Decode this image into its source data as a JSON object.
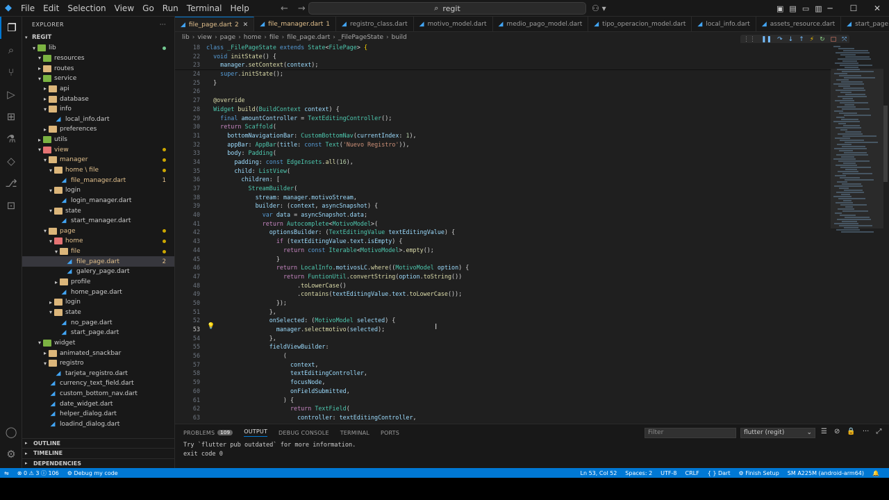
{
  "titlebar": {
    "menu": [
      "File",
      "Edit",
      "Selection",
      "View",
      "Go",
      "Run",
      "Terminal",
      "Help"
    ],
    "search": "regit"
  },
  "explorer": {
    "title": "EXPLORER",
    "root": "REGIT",
    "tree": [
      {
        "d": 1,
        "type": "folder",
        "c": "g",
        "open": true,
        "label": "lib",
        "dot": "g"
      },
      {
        "d": 2,
        "type": "folder",
        "c": "g",
        "open": true,
        "label": "resources"
      },
      {
        "d": 2,
        "type": "folder",
        "c": "",
        "open": false,
        "label": "routes"
      },
      {
        "d": 2,
        "type": "folder",
        "c": "g",
        "open": true,
        "label": "service"
      },
      {
        "d": 3,
        "type": "folder",
        "c": "",
        "open": false,
        "label": "api"
      },
      {
        "d": 3,
        "type": "folder",
        "c": "",
        "open": false,
        "label": "database"
      },
      {
        "d": 3,
        "type": "folder",
        "c": "",
        "open": true,
        "label": "info"
      },
      {
        "d": 4,
        "type": "file",
        "label": "local_info.dart"
      },
      {
        "d": 3,
        "type": "folder",
        "c": "",
        "open": false,
        "label": "preferences"
      },
      {
        "d": 2,
        "type": "folder",
        "c": "g",
        "open": false,
        "label": "utils"
      },
      {
        "d": 2,
        "type": "folder",
        "c": "r",
        "open": true,
        "label": "view",
        "mod": true,
        "dot": "o"
      },
      {
        "d": 3,
        "type": "folder",
        "c": "",
        "open": true,
        "label": "manager",
        "mod": true,
        "dot": "o"
      },
      {
        "d": 4,
        "type": "folder",
        "c": "",
        "open": true,
        "label": "home \\ file",
        "mod": true,
        "dot": "o"
      },
      {
        "d": 5,
        "type": "file",
        "label": "file_manager.dart",
        "mod": true,
        "cnt": "1"
      },
      {
        "d": 4,
        "type": "folder",
        "c": "",
        "open": true,
        "label": "login"
      },
      {
        "d": 5,
        "type": "file",
        "label": "login_manager.dart"
      },
      {
        "d": 4,
        "type": "folder",
        "c": "",
        "open": true,
        "label": "state"
      },
      {
        "d": 5,
        "type": "file",
        "label": "start_manager.dart"
      },
      {
        "d": 3,
        "type": "folder",
        "c": "",
        "open": true,
        "label": "page",
        "mod": true,
        "dot": "o"
      },
      {
        "d": 4,
        "type": "folder",
        "c": "r",
        "open": true,
        "label": "home",
        "mod": true,
        "dot": "o"
      },
      {
        "d": 5,
        "type": "folder",
        "c": "",
        "open": true,
        "label": "file",
        "mod": true,
        "dot": "o"
      },
      {
        "d": 6,
        "type": "file",
        "label": "file_page.dart",
        "mod": true,
        "sel": true,
        "cnt": "2"
      },
      {
        "d": 6,
        "type": "file",
        "label": "galery_page.dart"
      },
      {
        "d": 5,
        "type": "folder",
        "c": "",
        "open": false,
        "label": "profile"
      },
      {
        "d": 5,
        "type": "file",
        "label": "home_page.dart"
      },
      {
        "d": 4,
        "type": "folder",
        "c": "",
        "open": false,
        "label": "login"
      },
      {
        "d": 4,
        "type": "folder",
        "c": "",
        "open": true,
        "label": "state"
      },
      {
        "d": 5,
        "type": "file",
        "label": "no_page.dart"
      },
      {
        "d": 5,
        "type": "file",
        "label": "start_page.dart"
      },
      {
        "d": 2,
        "type": "folder",
        "c": "g",
        "open": true,
        "label": "widget"
      },
      {
        "d": 3,
        "type": "folder",
        "c": "",
        "open": false,
        "label": "animated_snackbar"
      },
      {
        "d": 3,
        "type": "folder",
        "c": "",
        "open": true,
        "label": "registro"
      },
      {
        "d": 4,
        "type": "file",
        "label": "tarjeta_registro.dart"
      },
      {
        "d": 3,
        "type": "file",
        "label": "currency_text_field.dart"
      },
      {
        "d": 3,
        "type": "file",
        "label": "custom_bottom_nav.dart"
      },
      {
        "d": 3,
        "type": "file",
        "label": "date_widget.dart"
      },
      {
        "d": 3,
        "type": "file",
        "label": "helper_dialog.dart"
      },
      {
        "d": 3,
        "type": "file",
        "label": "loadind_dialog.dart"
      }
    ],
    "sections": [
      "OUTLINE",
      "TIMELINE",
      "DEPENDENCIES"
    ]
  },
  "tabs": [
    {
      "label": "file_page.dart",
      "badge": "2",
      "active": true,
      "mod": true
    },
    {
      "label": "file_manager.dart",
      "badge": "1",
      "mod": true
    },
    {
      "label": "registro_class.dart"
    },
    {
      "label": "motivo_model.dart"
    },
    {
      "label": "medio_pago_model.dart"
    },
    {
      "label": "tipo_operacion_model.dart"
    },
    {
      "label": "local_info.dart"
    },
    {
      "label": "assets_resource.dart"
    },
    {
      "label": "start_page."
    }
  ],
  "breadcrumb": [
    "lib",
    "view",
    "page",
    "home",
    "file",
    "file_page.dart",
    "_FilePageState",
    "build"
  ],
  "editor": {
    "lines": [
      {
        "n": "18",
        "sticky": true,
        "html": "<span class=\"kb\">class</span> <span class=\"t\">_FilePageState</span> <span class=\"kb\">extends</span> <span class=\"t\">State</span>&lt;<span class=\"t\">FilePage</span>&gt; <span class=\"p\">{</span>"
      },
      {
        "n": "22",
        "sticky": true,
        "html": "  <span class=\"kb\">void</span> <span class=\"f\">initState</span>() {"
      },
      {
        "n": "23",
        "html": "    <span class=\"v\">manager</span>.<span class=\"f\">setContext</span>(<span class=\"v\">context</span>);"
      },
      {
        "n": "24",
        "html": "    <span class=\"kb\">super</span>.<span class=\"f\">initState</span>();"
      },
      {
        "n": "25",
        "html": "  }"
      },
      {
        "n": "26",
        "html": ""
      },
      {
        "n": "27",
        "html": "  <span class=\"a\">@override</span>"
      },
      {
        "n": "28",
        "html": "  <span class=\"t\">Widget</span> <span class=\"f\">build</span>(<span class=\"t\">BuildContext</span> <span class=\"v\">context</span>) {"
      },
      {
        "n": "29",
        "html": "    <span class=\"kb\">final</span> <span class=\"v\">amountController</span> = <span class=\"t\">TextEditingController</span>();"
      },
      {
        "n": "30",
        "html": "    <span class=\"k\">return</span> <span class=\"t\">Scaffold</span>("
      },
      {
        "n": "31",
        "html": "      <span class=\"v\">bottomNavigationBar</span>: <span class=\"t\">CustomBottomNav</span>(<span class=\"v\">currentIndex</span>: <span class=\"n\">1</span>),"
      },
      {
        "n": "32",
        "html": "      <span class=\"v\">appBar</span>: <span class=\"t\">AppBar</span>(<span class=\"v\">title</span>: <span class=\"kb\">const</span> <span class=\"t\">Text</span>(<span class=\"s\">'Nuevo Registro'</span>)),"
      },
      {
        "n": "33",
        "html": "      <span class=\"v\">body</span>: <span class=\"t\">Padding</span>("
      },
      {
        "n": "34",
        "html": "        <span class=\"v\">padding</span>: <span class=\"kb\">const</span> <span class=\"t\">EdgeInsets</span>.<span class=\"f\">all</span>(<span class=\"n\">16</span>),"
      },
      {
        "n": "35",
        "html": "        <span class=\"v\">child</span>: <span class=\"t\">ListView</span>("
      },
      {
        "n": "36",
        "html": "          <span class=\"v\">children</span>: ["
      },
      {
        "n": "37",
        "html": "            <span class=\"t\">StreamBuilder</span>("
      },
      {
        "n": "38",
        "html": "              <span class=\"v\">stream</span>: <span class=\"v\">manager</span>.<span class=\"v\">motivoStream</span>,"
      },
      {
        "n": "39",
        "html": "              <span class=\"v\">builder</span>: (<span class=\"v\">context</span>, <span class=\"v\">asyncSnapshot</span>) {"
      },
      {
        "n": "40",
        "html": "                <span class=\"kb\">var</span> <span class=\"v\">data</span> = <span class=\"v\">asyncSnapshot</span>.<span class=\"v\">data</span>;"
      },
      {
        "n": "41",
        "html": "                <span class=\"k\">return</span> <span class=\"t\">Autocomplete</span>&lt;<span class=\"t\">MotivoModel</span>&gt;("
      },
      {
        "n": "42",
        "html": "                  <span class=\"v\">optionsBuilder</span>: (<span class=\"t\">TextEditingValue</span> <span class=\"v\">textEditingValue</span>) {"
      },
      {
        "n": "43",
        "html": "                    <span class=\"k\">if</span> (<span class=\"v\">textEditingValue</span>.<span class=\"v\">text</span>.<span class=\"v\">isEmpty</span>) {"
      },
      {
        "n": "44",
        "html": "                      <span class=\"k\">return</span> <span class=\"kb\">const</span> <span class=\"t\">Iterable</span>&lt;<span class=\"t\">MotivoModel</span>&gt;.<span class=\"f\">empty</span>();"
      },
      {
        "n": "45",
        "html": "                    }"
      },
      {
        "n": "46",
        "html": "                    <span class=\"k\">return</span> <span class=\"t\">LocalInfo</span>.<span class=\"v\">motivosLC</span>.<span class=\"f\">where</span>((<span class=\"t\">MotivoModel</span> <span class=\"v\">option</span>) {"
      },
      {
        "n": "47",
        "html": "                      <span class=\"k\">return</span> <span class=\"t\">FuntionUtil</span>.<span class=\"f\">convertString</span>(<span class=\"v\">option</span>.<span class=\"f\">toString</span>())"
      },
      {
        "n": "48",
        "html": "                          .<span class=\"f\">toLowerCase</span>()"
      },
      {
        "n": "49",
        "html": "                          .<span class=\"f\">contains</span>(<span class=\"v\">textEditingValue</span>.<span class=\"v\">text</span>.<span class=\"f\">toLowerCase</span>());"
      },
      {
        "n": "50",
        "html": "                    });"
      },
      {
        "n": "51",
        "html": "                  },"
      },
      {
        "n": "52",
        "html": "                  <span class=\"v\">onSelected</span>: (<span class=\"t\">MotivoModel</span> <span class=\"v\">selected</span>) {"
      },
      {
        "n": "53",
        "cur": true,
        "html": "                    <span class=\"v\">manager</span>.<span class=\"f\">selectmotivo</span>(<span class=\"v\">selected</span>);"
      },
      {
        "n": "54",
        "html": "                  },"
      },
      {
        "n": "55",
        "html": "                  <span class=\"v\">fieldViewBuilder</span>:"
      },
      {
        "n": "56",
        "html": "                      ("
      },
      {
        "n": "57",
        "html": "                        <span class=\"v\">context</span>,"
      },
      {
        "n": "58",
        "html": "                        <span class=\"v\">textEditingController</span>,"
      },
      {
        "n": "59",
        "html": "                        <span class=\"v\">focusNode</span>,"
      },
      {
        "n": "60",
        "html": "                        <span class=\"v\">onFieldSubmitted</span>,"
      },
      {
        "n": "61",
        "html": "                      ) {"
      },
      {
        "n": "62",
        "html": "                        <span class=\"k\">return</span> <span class=\"t\">TextField</span>("
      },
      {
        "n": "63",
        "html": "                          <span class=\"v\">controller</span>: <span class=\"v\">textEditingController</span>,"
      }
    ]
  },
  "panel": {
    "tabs": [
      {
        "label": "PROBLEMS",
        "badge": "109"
      },
      {
        "label": "OUTPUT",
        "active": true
      },
      {
        "label": "DEBUG CONSOLE"
      },
      {
        "label": "TERMINAL"
      },
      {
        "label": "PORTS"
      }
    ],
    "filter_placeholder": "Filter",
    "channel": "flutter (regit)",
    "output": [
      "Try `flutter pub outdated` for more information.",
      "exit code 0"
    ]
  },
  "status": {
    "errors": "0",
    "warnings": "3",
    "info": "106",
    "debug": "Debug my code",
    "position": "Ln 53, Col 52",
    "spaces": "Spaces: 2",
    "encoding": "UTF-8",
    "eol": "CRLF",
    "language": "Dart",
    "setup": "Finish Setup",
    "device": "SM A225M (android-arm64)"
  },
  "colors": {
    "accent": "#0078d4",
    "background": "#1f1f1f",
    "modified": "#e2c08d"
  }
}
